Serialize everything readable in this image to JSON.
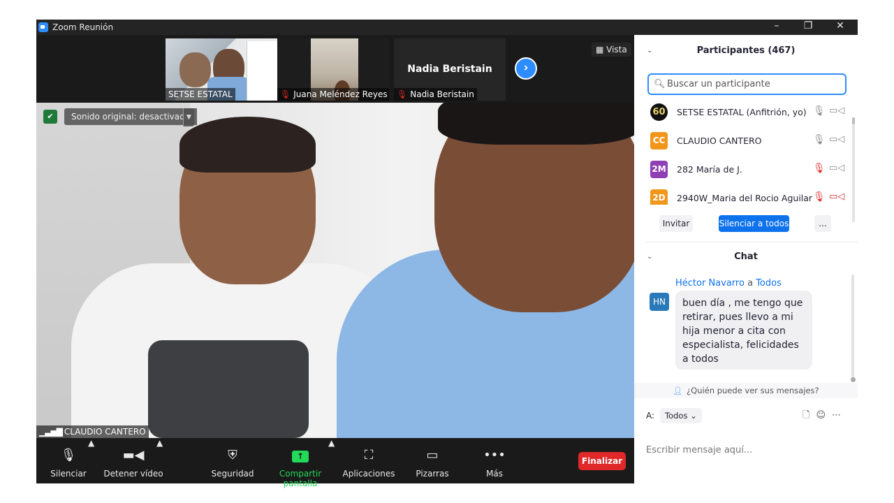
{
  "window": {
    "title": "Zoom Reunión",
    "controls": [
      "–",
      "❐",
      "✕"
    ]
  },
  "thumbnails": [
    {
      "name": "SETSE ESTATAL",
      "muted": false
    },
    {
      "name": "Juana Meléndez Reyes",
      "muted": true
    },
    {
      "name": "Nadia Beristain",
      "muted": true,
      "big_label": "Nadia Beristain"
    }
  ],
  "view_button": "Vista",
  "video": {
    "sound_label": "Sonido original: desactivado",
    "speaker": "CLAUDIO CANTERO"
  },
  "toolbar": {
    "mute": "Silenciar",
    "stop_video": "Detener vídeo",
    "security": "Seguridad",
    "share": "Compartir pantalla",
    "apps": "Aplicaciones",
    "whiteboards": "Pizarras",
    "more": "Más",
    "end": "Finalizar"
  },
  "participants": {
    "header": "Participantes (467)",
    "search_placeholder": "Buscar un participante",
    "list": [
      {
        "initials": "60",
        "name": "SETSE ESTATAL (Anfitrión, yo)",
        "color": "#111111",
        "mic_off": false,
        "cam_off": false
      },
      {
        "initials": "CC",
        "name": "CLAUDIO CANTERO",
        "color": "#f0961a",
        "mic_off": false,
        "cam_off": false
      },
      {
        "initials": "2M",
        "name": "282 María de J.",
        "color": "#8e3fb4",
        "mic_off": true,
        "cam_off": false
      },
      {
        "initials": "2D",
        "name": "2940W_Maria del Rocio Aguilar",
        "color": "#f0961a",
        "mic_off": true,
        "cam_off": true
      }
    ],
    "invite": "Invitar",
    "mute_all": "Silenciar a todos",
    "more": "..."
  },
  "chat": {
    "header": "Chat",
    "sender": "Héctor Navarro",
    "to_word": "a",
    "recipient": "Todos",
    "avatar": "HN",
    "message": "buen día , me tengo que retirar, pues llevo a mi hija menor a cita con especialista, felicidades a todos",
    "who_sees": "¿Quién puede ver sus mensajes?",
    "to_label": "A:",
    "to_value": "Todos",
    "input_placeholder": "Escribir mensaje aquí..."
  },
  "colors": {
    "accent": "#2d8cff",
    "end": "#e02828",
    "share": "#23d959"
  }
}
